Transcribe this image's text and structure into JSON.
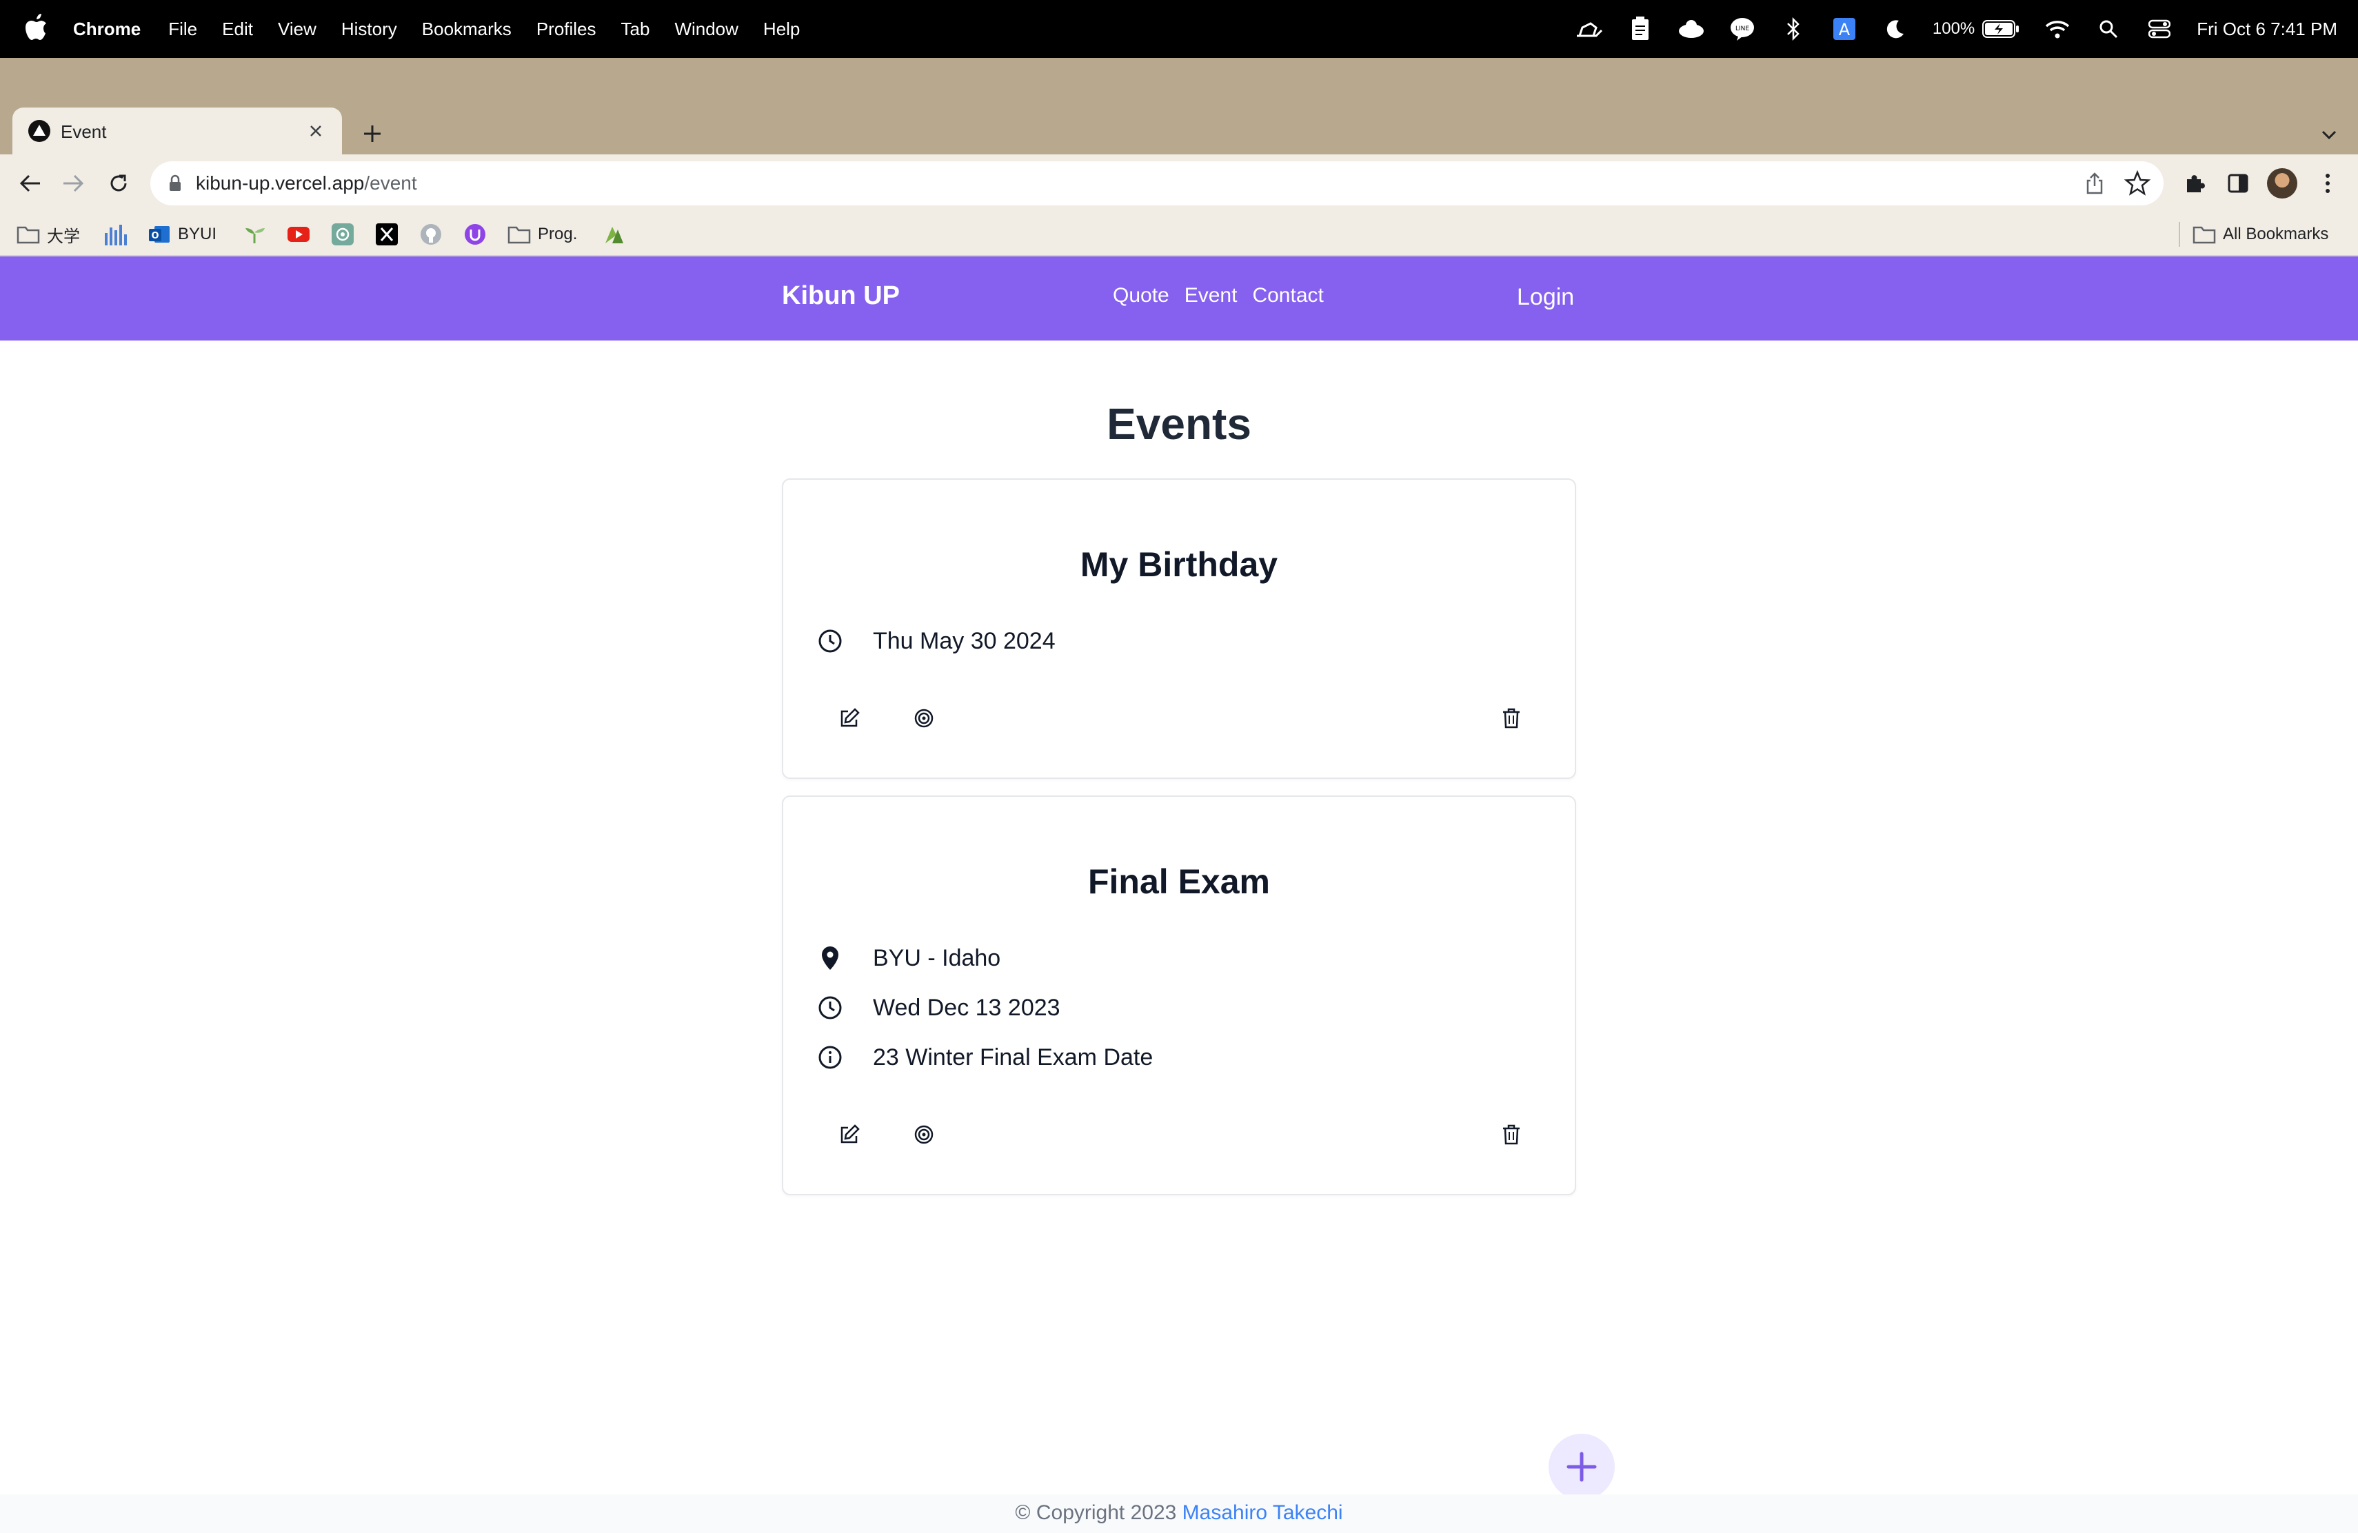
{
  "menubar": {
    "app": "Chrome",
    "items": [
      "File",
      "Edit",
      "View",
      "History",
      "Bookmarks",
      "Profiles",
      "Tab",
      "Window",
      "Help"
    ],
    "battery": "100%",
    "clock": "Fri Oct 6  7:41 PM"
  },
  "browser": {
    "tab_title": "Event",
    "url_host": "kibun-up.vercel.app",
    "url_path": "/event",
    "bookmarks": [
      "大学",
      "BYUI",
      "Prog."
    ],
    "all_bookmarks": "All Bookmarks"
  },
  "site": {
    "brand": "Kibun UP",
    "nav": [
      "Quote",
      "Event",
      "Contact"
    ],
    "login": "Login",
    "page_title": "Events",
    "events": [
      {
        "title": "My Birthday",
        "date": "Thu May 30 2024"
      },
      {
        "title": "Final Exam",
        "location": "BYU - Idaho",
        "date": "Wed Dec 13 2023",
        "description": "23 Winter Final Exam Date"
      }
    ],
    "footer_prefix": "© Copyright 2023 ",
    "footer_author": "Masahiro Takechi"
  },
  "colors": {
    "nav_bg": "#8661f0",
    "tabstrip_bg": "#b8a98e",
    "fab_bg": "#ede9fe",
    "fab_icon": "#7c5ce6",
    "footer_link": "#3b82f6"
  },
  "icons": {
    "clock": "clock-icon",
    "location": "map-pin-icon",
    "info": "info-icon",
    "edit": "edit-icon",
    "target": "target-icon",
    "delete": "trash-icon",
    "add": "plus-icon"
  }
}
